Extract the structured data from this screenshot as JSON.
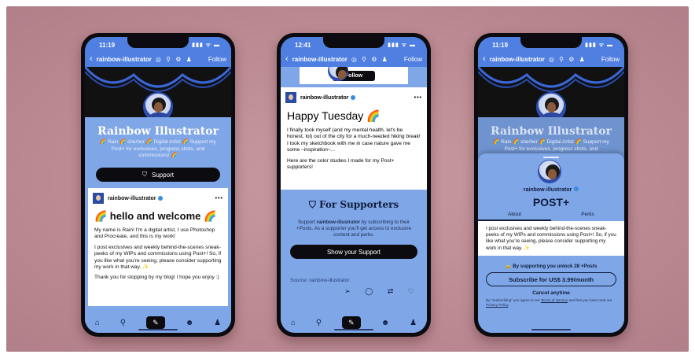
{
  "phone1": {
    "time": "11:19",
    "status_icons": "▮▮▮ ᯤ ▬",
    "nav": {
      "back": "‹",
      "username": "rainbow-illustrator",
      "icons": "◎ ⚲ ⚙ ♟",
      "follow": "Follow"
    },
    "blog_title": "Rainbow Illustrator",
    "blog_desc": "🌈 Rain 🌈 she/her 🌈 Digital Artist 🌈 Support my Post+ for exclusives, progress shots, and commissions! 🌈",
    "support_label": "Support",
    "post": {
      "author": "rainbow-illustrator",
      "dots": "•••",
      "heading": "🌈 hello and welcome 🌈",
      "paragraphs": [
        "My name is Rain! I'm a digital artist, I use Photoshop and Procreate, and this is my work!",
        "I post exclusives and weekly behind-the-scenes sneak-peeks of my WIPs and commissions using Post+! So, if you like what you're seeing, please consider supporting my work in that way. ✨",
        "Thank you for stopping by my blog! I hope you enjoy :)"
      ]
    }
  },
  "phone2": {
    "time": "12:41",
    "status_icons": "▮▮▮ ᯤ ▬",
    "nav": {
      "back": "‹",
      "username": "rainbow-illustrator",
      "icons": "◎ ⚲ ⚙ ♟",
      "follow": "Follow"
    },
    "follow_btn": "Follow",
    "post": {
      "author": "rainbow-illustrator",
      "dots": "•••",
      "heading": "Happy Tuesday 🌈",
      "paragraphs": [
        "I finally took myself (and my mental health, let's be honest, lol) out of the city for a much-needed hiking break! I took my sketchbook with me in case nature gave me some ~inspiration~...",
        "Here are the color studies I made for my Post+ supporters!"
      ]
    },
    "for_supporters": "For Supporters",
    "support_desc_1": "Support ",
    "support_desc_author": "rainbow-illustrator",
    "support_desc_2": " by subscribing to their +Posts. As a supporter you'll get access to exclusive content and perks.",
    "show_support": "Show your Support",
    "source": "Source: rainbow-illustrator",
    "actions": "➢ ◯ ⇄ ♡"
  },
  "phone3": {
    "time": "11:19",
    "status_icons": "▮▮▮ ᯤ ▬",
    "nav": {
      "back": "‹",
      "username": "rainbow-illustrator",
      "icons": "◎ ⚲ ⚙ ♟",
      "follow": "Follow"
    },
    "blog_title": "Rainbow Illustrator",
    "blog_desc": "🌈 Rain 🌈 she/her 🌈 Digital Artist 🌈 Support my Post+ for exclusives, progress shots, and",
    "sheet": {
      "name": "rainbow-illustrator",
      "title": "POST+",
      "tab_about": "About",
      "tab_perks": "Perks",
      "about": "I post exclusives and weekly behind-the-scenes sneak-peeks of my WIPs and commissions using Post+! So, if you like what you're seeing, please consider supporting my work in that way. ✨",
      "unlock": "🔒 By supporting you unlock 28 +Posts",
      "subscribe": "Subscribe for US$ 3.99/month",
      "cancel": "Cancel anytime",
      "legal_1": "By \"Subscribing\" you agree to our ",
      "legal_terms": "Terms of Service",
      "legal_2": " and that you have read our ",
      "legal_privacy": "Privacy Policy",
      "legal_3": "."
    }
  },
  "tabbar": {
    "home": "⌂",
    "search": "⚲",
    "pen": "✎",
    "chat": "☻",
    "account": "♟"
  }
}
